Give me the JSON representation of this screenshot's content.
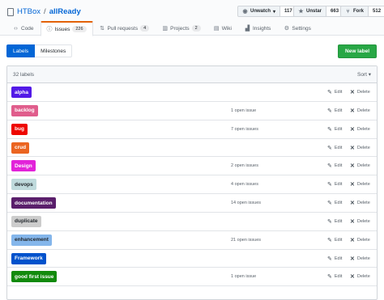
{
  "repo": {
    "owner": "HTBox",
    "separator": "/",
    "name": "allReady"
  },
  "actions": {
    "unwatch": {
      "label": "Unwatch",
      "count": "117"
    },
    "unstar": {
      "label": "Unstar",
      "count": "663"
    },
    "fork": {
      "label": "Fork",
      "count": "512"
    }
  },
  "tabs": [
    {
      "label": "Code"
    },
    {
      "label": "Issues",
      "count": "226"
    },
    {
      "label": "Pull requests",
      "count": "4"
    },
    {
      "label": "Projects",
      "count": "2"
    },
    {
      "label": "Wiki"
    },
    {
      "label": "Insights"
    },
    {
      "label": "Settings"
    }
  ],
  "subnav": {
    "labels": "Labels",
    "milestones": "Milestones"
  },
  "new_label": "New label",
  "list": {
    "count_text": "32 labels",
    "sort": "Sort",
    "edit": "Edit",
    "delete": "Delete",
    "labels": [
      {
        "name": "alpha",
        "issues": "",
        "bg": "#5319e7",
        "fg": "#ffffff"
      },
      {
        "name": "backlog",
        "issues": "1 open issue",
        "bg": "#e05d8c",
        "fg": "#ffffff"
      },
      {
        "name": "bug",
        "issues": "7 open issues",
        "bg": "#ee0701",
        "fg": "#ffffff"
      },
      {
        "name": "crud",
        "issues": "",
        "bg": "#eb6420",
        "fg": "#ffffff"
      },
      {
        "name": "Design",
        "issues": "2 open issues",
        "bg": "#e223d9",
        "fg": "#ffffff"
      },
      {
        "name": "devops",
        "issues": "4 open issues",
        "bg": "#bfdadc",
        "fg": "#24292e"
      },
      {
        "name": "documentation",
        "issues": "14 open issues",
        "bg": "#5a1e6b",
        "fg": "#ffffff"
      },
      {
        "name": "duplicate",
        "issues": "",
        "bg": "#cccccc",
        "fg": "#24292e"
      },
      {
        "name": "enhancement",
        "issues": "21 open issues",
        "bg": "#84b6eb",
        "fg": "#24292e"
      },
      {
        "name": "Framework",
        "issues": "",
        "bg": "#0052cc",
        "fg": "#ffffff"
      },
      {
        "name": "good first issue",
        "issues": "1 open issue",
        "bg": "#128a0c",
        "fg": "#ffffff"
      }
    ]
  }
}
